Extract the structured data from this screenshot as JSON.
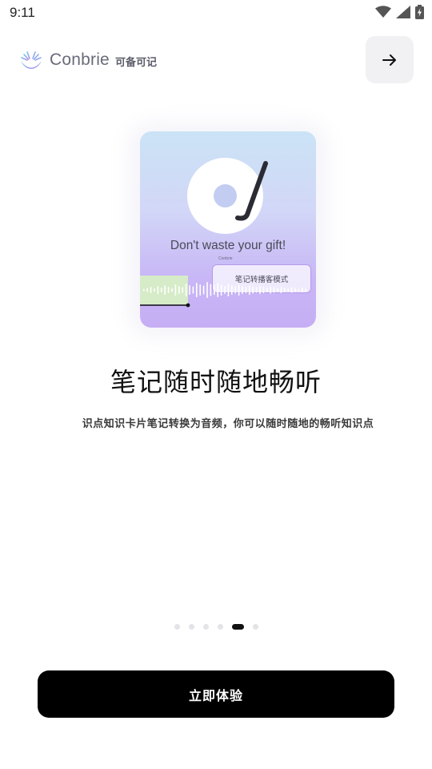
{
  "status_bar": {
    "time": "9:11",
    "icons": [
      "wifi-icon",
      "signal-icon",
      "battery-charging-icon"
    ]
  },
  "header": {
    "brand_name": "Conbrie",
    "brand_cn": "可备可记",
    "next_icon": "arrow-right-icon"
  },
  "illustration": {
    "slogan": "Don't waste your gift!",
    "brand_tiny": "Conbrie",
    "mode_tag": "笔记转播客模式",
    "colors": {
      "top": "#cbe3f6",
      "bottom": "#c6aef4",
      "wave_played": "#d7f1c2"
    }
  },
  "onboarding": {
    "title": "笔记随时随地畅听",
    "subtitle": "识点知识卡片笔记转换为音频，你可以随时随地的畅听知识点"
  },
  "pager": {
    "total": 6,
    "current": 5
  },
  "cta": {
    "label": "立即体验"
  }
}
